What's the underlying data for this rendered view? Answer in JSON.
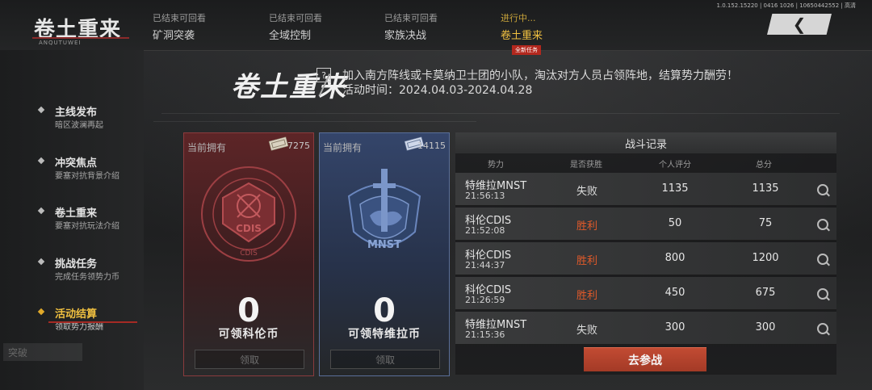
{
  "header": {
    "logo": "卷土重来",
    "logo_sub": "ANQUTUWEI",
    "tabs": [
      {
        "status": "已结束可回看",
        "name": "矿洞突袭"
      },
      {
        "status": "已结束可回看",
        "name": "全域控制"
      },
      {
        "status": "已结束可回看",
        "name": "家族决战"
      },
      {
        "status": "进行中...",
        "name": "卷土重来",
        "badge": "全新任务"
      }
    ],
    "back_icon": "chevron-left-icon",
    "sys_info": "1.0.152.15220 | 0416 1026 | 10650442552 | 高清"
  },
  "sidebar": {
    "items": [
      {
        "title": "主线发布",
        "subtitle": "暗区波澜再起"
      },
      {
        "title": "冲突焦点",
        "subtitle": "要塞对抗背景介绍"
      },
      {
        "title": "卷土重来",
        "subtitle": "要塞对抗玩法介绍"
      },
      {
        "title": "挑战任务",
        "subtitle": "完成任务领势力币"
      },
      {
        "title": "活动结算",
        "subtitle": "领取势力报酬"
      }
    ],
    "footer_button": "突破"
  },
  "event": {
    "title": "卷土重来",
    "help": "?",
    "description": "加入南方阵线或卡莫纳卫士团的小队，淘汰对方人员占领阵地，结算势力酬劳！",
    "period": "活动时间：2024.04.03-2024.04.28"
  },
  "cards": [
    {
      "own_label": "当前拥有",
      "own_count": "7275",
      "emblem_top": "CDIS",
      "emblem_bottom": "CDIS",
      "emblem_ring": "ONOM DEFENSE INTELLIGENCE SERVICE",
      "value": "0",
      "label": "可领科伦币",
      "claim": "领取",
      "accent": "#c0494d"
    },
    {
      "own_label": "当前拥有",
      "own_count": "14115",
      "emblem_text": "MNST",
      "value": "0",
      "label": "可领特维拉币",
      "claim": "领取",
      "accent": "#5a7bb8"
    }
  ],
  "record": {
    "title": "战斗记录",
    "columns": [
      "势力",
      "是否获胜",
      "个人评分",
      "总分"
    ],
    "rows": [
      {
        "faction": "特维拉MNST",
        "time": "21:56:13",
        "result": "失败",
        "win": false,
        "personal": "1135",
        "total": "1135"
      },
      {
        "faction": "科伦CDIS",
        "time": "21:52:08",
        "result": "胜利",
        "win": true,
        "personal": "50",
        "total": "75"
      },
      {
        "faction": "科伦CDIS",
        "time": "21:44:37",
        "result": "胜利",
        "win": true,
        "personal": "800",
        "total": "1200"
      },
      {
        "faction": "科伦CDIS",
        "time": "21:26:59",
        "result": "胜利",
        "win": true,
        "personal": "450",
        "total": "675"
      },
      {
        "faction": "特维拉MNST",
        "time": "21:15:36",
        "result": "失败",
        "win": false,
        "personal": "300",
        "total": "300"
      }
    ],
    "join_button": "去参战",
    "colors": {
      "win": "#e15a2a",
      "lose": "#dcdcdc"
    }
  }
}
